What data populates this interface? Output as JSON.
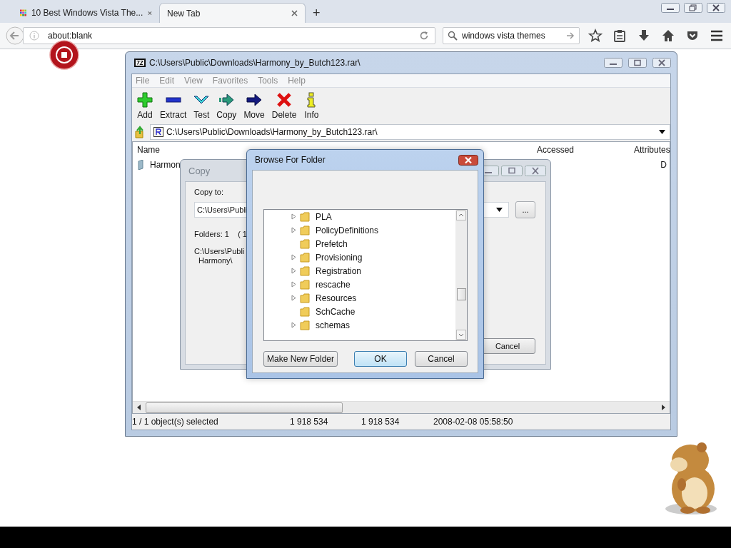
{
  "browser": {
    "tabs": [
      {
        "label": "10 Best Windows Vista The...",
        "selected": false
      },
      {
        "label": "New Tab",
        "selected": true
      }
    ],
    "new_tab": "+",
    "address": "about:blank",
    "search": "windows vista themes"
  },
  "archiver": {
    "title": "C:\\Users\\Public\\Downloads\\Harmony_by_Butch123.rar\\",
    "menu": [
      "File",
      "Edit",
      "View",
      "Favorites",
      "Tools",
      "Help"
    ],
    "toolbar": [
      {
        "label": "Add",
        "kind": "add"
      },
      {
        "label": "Extract",
        "kind": "extract"
      },
      {
        "label": "Test",
        "kind": "test"
      },
      {
        "label": "Copy",
        "kind": "copy"
      },
      {
        "label": "Move",
        "kind": "move"
      },
      {
        "label": "Delete",
        "kind": "delete"
      },
      {
        "label": "Info",
        "kind": "info"
      }
    ],
    "path": "C:\\Users\\Public\\Downloads\\Harmony_by_Butch123.rar\\",
    "columns": [
      "Name",
      "Accessed",
      "Attributes"
    ],
    "row": {
      "name": "Harmon",
      "attributes": "D"
    },
    "status": [
      "1 / 1 object(s) selected",
      "1 918 534",
      "1 918 534",
      "2008-02-08 05:58:50"
    ]
  },
  "copy_dialog": {
    "title": "Copy",
    "copy_to_label": "Copy to:",
    "path_value": "C:\\Users\\Publi",
    "browse": "...",
    "folders": "Folders: 1    ( 1",
    "target_lines": [
      "C:\\Users\\Publi",
      "Harmony\\"
    ],
    "cancel": "Cancel"
  },
  "browse_dialog": {
    "title": "Browse For Folder",
    "folders": [
      {
        "name": "PLA",
        "expandable": true
      },
      {
        "name": "PolicyDefinitions",
        "expandable": true
      },
      {
        "name": "Prefetch",
        "expandable": false
      },
      {
        "name": "Provisioning",
        "expandable": true
      },
      {
        "name": "Registration",
        "expandable": true
      },
      {
        "name": "rescache",
        "expandable": true
      },
      {
        "name": "Resources",
        "expandable": true
      },
      {
        "name": "SchCache",
        "expandable": false
      },
      {
        "name": "schemas",
        "expandable": true
      }
    ],
    "make_new_folder": "Make New Folder",
    "ok": "OK",
    "cancel": "Cancel"
  }
}
